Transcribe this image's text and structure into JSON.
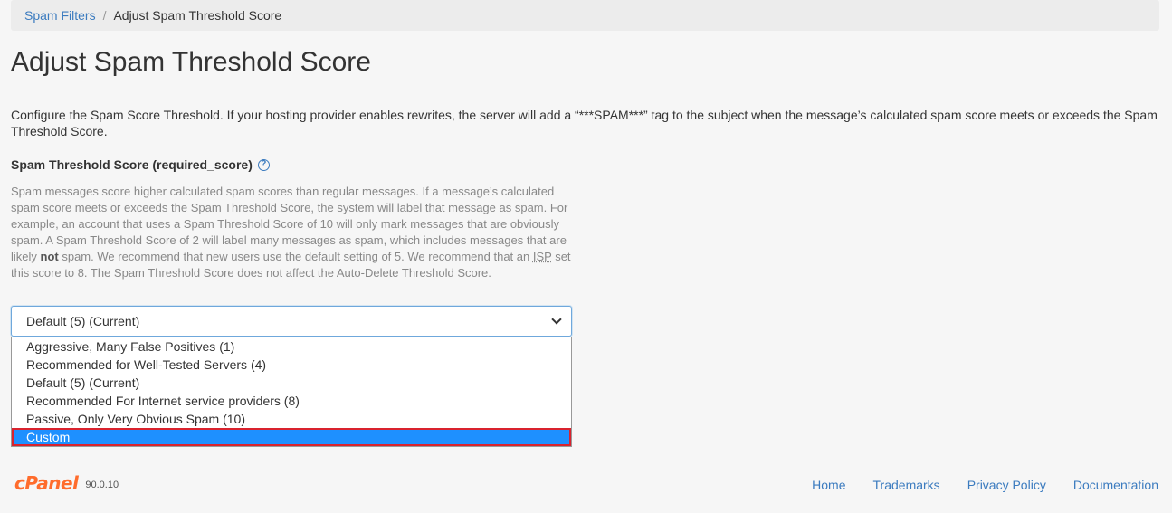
{
  "breadcrumb": {
    "parent": "Spam Filters",
    "separator": "/",
    "current": "Adjust Spam Threshold Score"
  },
  "page_title": "Adjust Spam Threshold Score",
  "intro": "Configure the Spam Score Threshold. If your hosting provider enables rewrites, the server will add a “***SPAM***” tag to the subject when the message’s calculated spam score meets or exceeds the Spam Threshold Score.",
  "field": {
    "label": "Spam Threshold Score (required_score)",
    "help_icon": "question-circle-icon",
    "help_part1": "Spam messages score higher calculated spam scores than regular messages. If a message’s calculated spam score meets or exceeds the Spam Threshold Score, the system will label that message as spam. For example, an account that uses a Spam Threshold Score of 10 will only mark messages that are obviously spam. A Spam Threshold Score of 2 will label many messages as spam, which includes messages that are likely ",
    "help_bold": "not",
    "help_part2": " spam. We recommend that new users use the default setting of 5. We recommend that an ",
    "help_abbr": "ISP",
    "help_part3": " set this score to 8. The Spam Threshold Score does not affect the Auto-Delete Threshold Score."
  },
  "select": {
    "value": "Default (5) (Current)",
    "options": [
      "Aggressive, Many False Positives (1)",
      "Recommended for Well-Tested Servers (4)",
      "Default (5) (Current)",
      "Recommended For Internet service providers (8)",
      "Passive, Only Very Obvious Spam (10)",
      "Custom"
    ],
    "highlighted": "Custom"
  },
  "footer": {
    "logo": "cPanel",
    "version": "90.0.10",
    "links": [
      "Home",
      "Trademarks",
      "Privacy Policy",
      "Documentation"
    ]
  },
  "colors": {
    "link": "#3b7bbf",
    "highlight": "#1e90ff",
    "highlight_border": "#d9232e",
    "logo": "#ff6c2c"
  }
}
